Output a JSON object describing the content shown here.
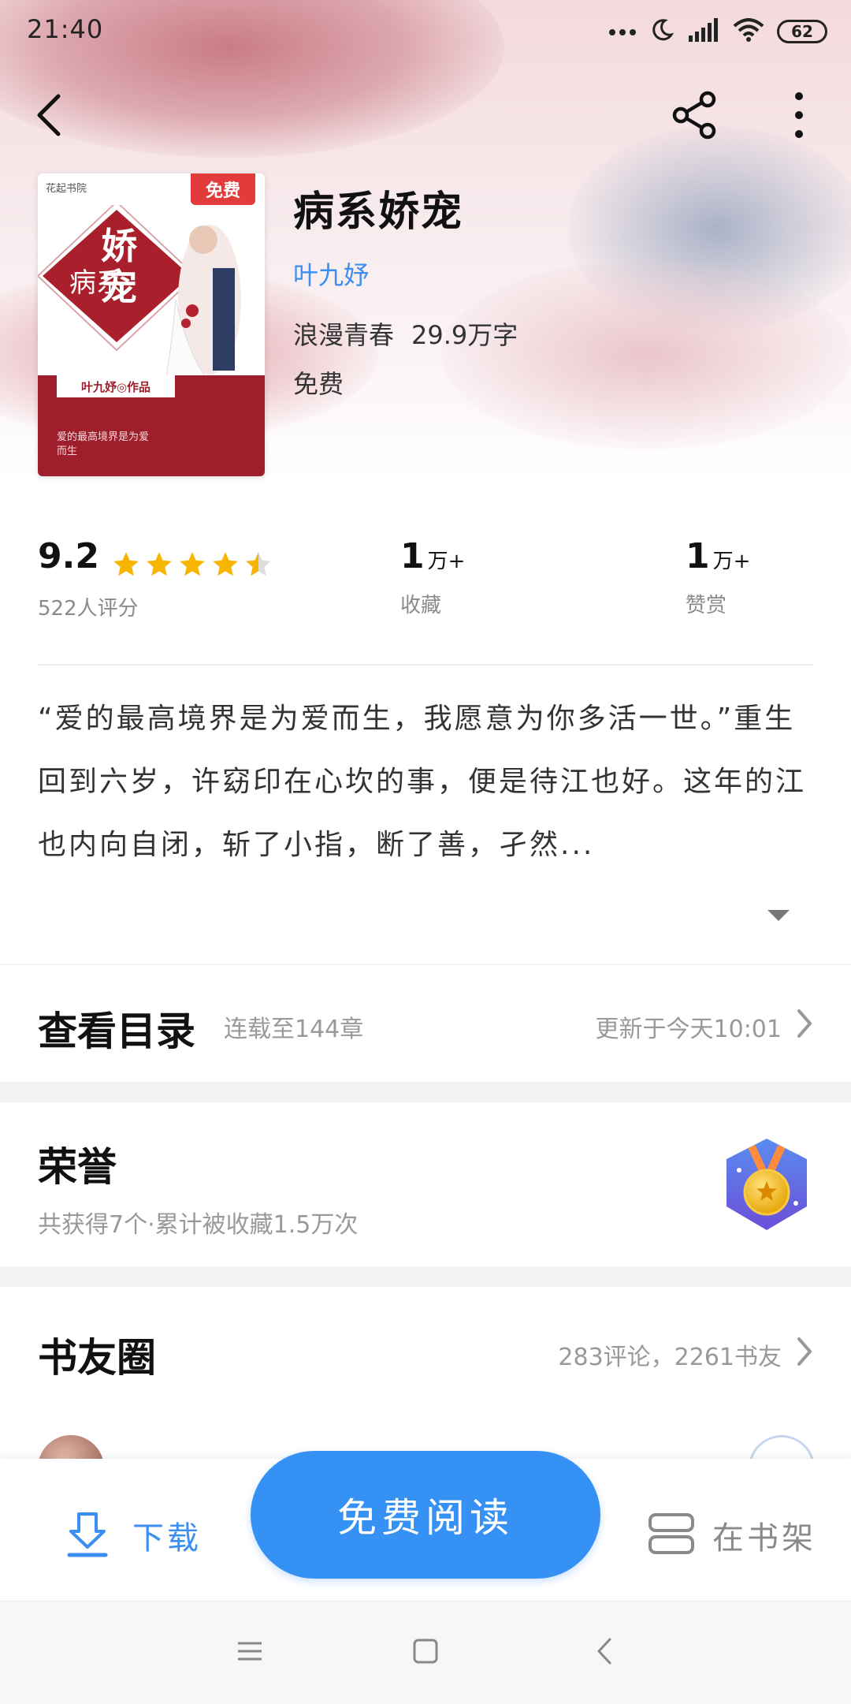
{
  "status_bar": {
    "time": "21:40",
    "battery": "62"
  },
  "book": {
    "title": "病系娇宠",
    "author": "叶九妤",
    "genre": "浪漫青春",
    "word_count": "29.9万字",
    "price": "免费",
    "cover": {
      "free_tag": "免费",
      "author_text": "叶九妤◎作品",
      "tagline": "爱的最高境界是为爱而生",
      "publisher": "花起书院",
      "title_chars_small": "病系",
      "title_chars_big": "娇宠"
    }
  },
  "stats": {
    "rating": "9.2",
    "rating_count": "522人评分",
    "favorites_value": "1",
    "favorites_unit": "万+",
    "favorites_label": "收藏",
    "rewards_value": "1",
    "rewards_unit": "万+",
    "rewards_label": "赞赏",
    "stars_full": 4,
    "stars_half": 1
  },
  "description": "“爱的最高境界是为爱而生，我愿意为你多活一世。”重生回到六岁，许窈印在心坎的事，便是待江也好。这年的江也内向自闭，斩了小指，断了善，孑然...",
  "catalog": {
    "title": "查看目录",
    "status": "连载至144章",
    "updated": "更新于今天10:01"
  },
  "honor": {
    "title": "荣誉",
    "summary": "共获得7个·累计被收藏1.5万次"
  },
  "circle": {
    "title": "书友圈",
    "summary": "283评论，2261书友"
  },
  "actions": {
    "download": "下载",
    "read": "免费阅读",
    "shelf": "在书架"
  },
  "colors": {
    "accent": "#3591f3",
    "link": "#3a8ff0",
    "star": "#f7b500",
    "cover_red": "#9e1f2b"
  }
}
